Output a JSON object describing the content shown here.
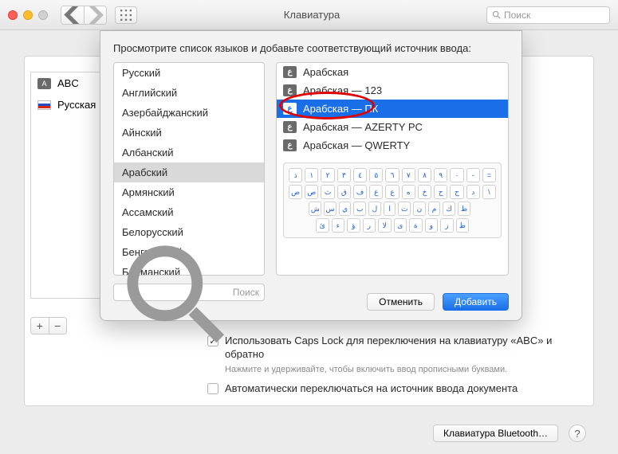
{
  "window": {
    "title": "Клавиатура",
    "search_placeholder": "Поиск"
  },
  "sidebar": {
    "sources": [
      {
        "icon": "A",
        "label": "ABC"
      },
      {
        "icon": "flag-ru",
        "label": "Русская"
      }
    ]
  },
  "checkboxes": {
    "caps_label": "Использовать Caps Lock для переключения на клавиатуру «ABC» и обратно",
    "caps_hint": "Нажмите и удерживайте, чтобы включить ввод прописными буквами.",
    "auto_label": "Автоматически переключаться на источник ввода документа"
  },
  "bluetooth_btn": "Клавиатура Bluetooth…",
  "sheet": {
    "prompt": "Просмотрите список языков и добавьте соответствующий источник ввода:",
    "languages": [
      "Русский",
      "Английский",
      "Азербайджанский",
      "Айнский",
      "Албанский",
      "Арабский",
      "Армянский",
      "Ассамский",
      "Белорусский",
      "Бенгальский",
      "Бирманский"
    ],
    "selected_language_index": 5,
    "layouts": [
      "Арабская",
      "Арабская — 123",
      "Арабская — ПК",
      "Арабская — AZERTY PC",
      "Арабская — QWERTY"
    ],
    "selected_layout_index": 2,
    "keyboard_rows": [
      [
        "ذ",
        "١",
        "٢",
        "٣",
        "٤",
        "٥",
        "٦",
        "٧",
        "٨",
        "٩",
        "٠",
        "-",
        "="
      ],
      [
        "ض",
        "ص",
        "ث",
        "ق",
        "ف",
        "غ",
        "ع",
        "ه",
        "خ",
        "ح",
        "ج",
        "د",
        "\\"
      ],
      [
        "ش",
        "س",
        "ي",
        "ب",
        "ل",
        "ا",
        "ت",
        "ن",
        "م",
        "ك",
        "ط"
      ],
      [
        "ئ",
        "ء",
        "ؤ",
        "ر",
        "لا",
        "ى",
        "ة",
        "و",
        "ز",
        "ظ"
      ]
    ],
    "search_placeholder": "Поиск",
    "cancel": "Отменить",
    "add": "Добавить"
  }
}
